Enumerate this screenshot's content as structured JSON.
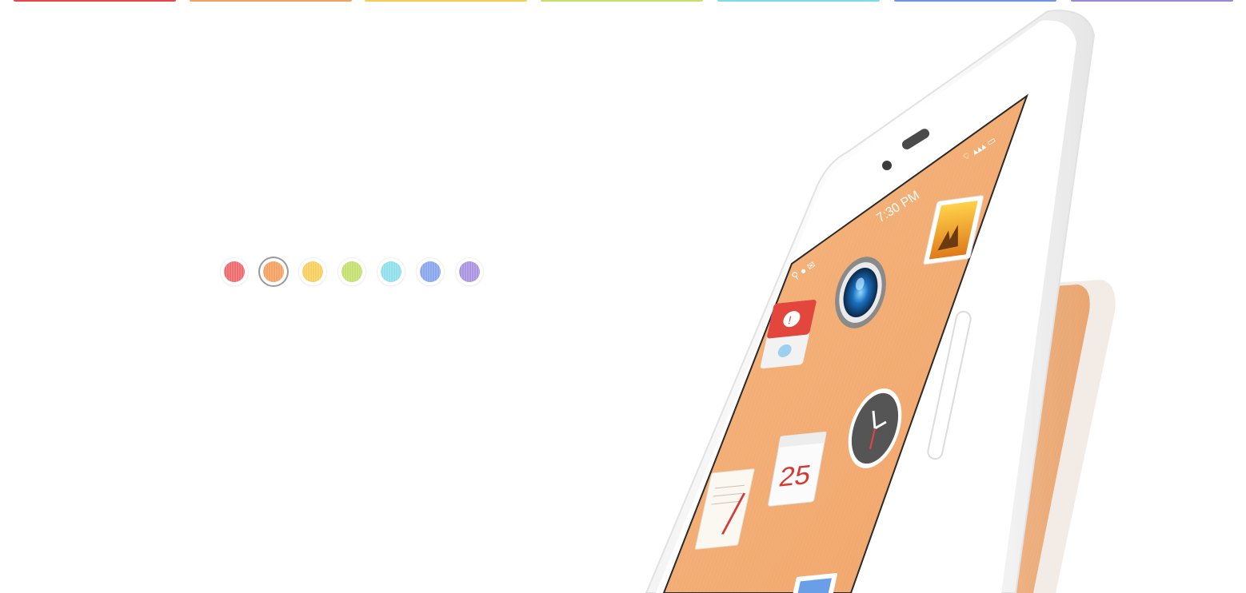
{
  "top_bars": [
    {
      "name": "red",
      "color": "#e8474a"
    },
    {
      "name": "orange",
      "color": "#f3a15c"
    },
    {
      "name": "yellow",
      "color": "#f6cf51"
    },
    {
      "name": "lime",
      "color": "#c6e06a"
    },
    {
      "name": "cyan",
      "color": "#7cdde8"
    },
    {
      "name": "blue",
      "color": "#6c95ea"
    },
    {
      "name": "purple",
      "color": "#9b86d9"
    }
  ],
  "color_options": [
    {
      "name": "red",
      "color": "#ef6b6f",
      "selected": false
    },
    {
      "name": "orange",
      "color": "#f6a262",
      "selected": true
    },
    {
      "name": "yellow",
      "color": "#f7cf61",
      "selected": false
    },
    {
      "name": "lime",
      "color": "#c4e070",
      "selected": false
    },
    {
      "name": "cyan",
      "color": "#8fe0ea",
      "selected": false
    },
    {
      "name": "blue",
      "color": "#8aa6ef",
      "selected": false
    },
    {
      "name": "purple",
      "color": "#ab95e0",
      "selected": false
    }
  ],
  "phone": {
    "status_time": "7:30 PM",
    "screen_color": "#f3ad72",
    "back_color": "#ebaa76",
    "calendar_day": "25",
    "app_icons": [
      "album-app-icon",
      "camera-app-icon",
      "flag-app-icon",
      "clock-app-icon",
      "calendar-app-icon",
      "notes-app-icon",
      "mail-app-icon"
    ]
  }
}
